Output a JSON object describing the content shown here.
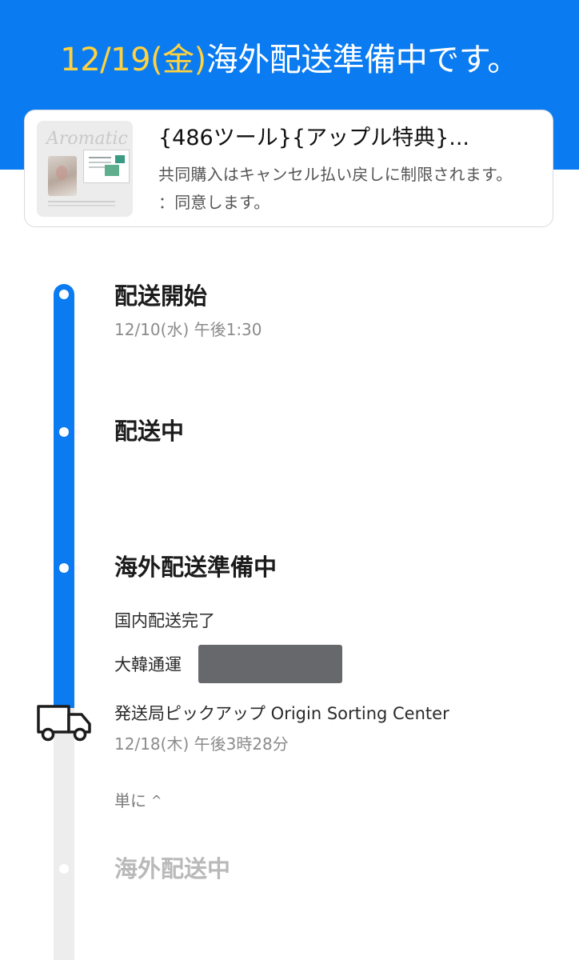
{
  "header": {
    "date": "12/19(金)",
    "status_text": "海外配送準備中です。"
  },
  "product": {
    "thumbnail_text": "Aromatic",
    "title": "{486ツール}{アップル特典}...",
    "note": "共同購入はキャンセル払い戻しに制限されます。 ：同意します。"
  },
  "timeline": {
    "steps": [
      {
        "title": "配送開始",
        "time": "12/10(水) 午後1:30",
        "state": "done"
      },
      {
        "title": "配送中",
        "state": "done"
      },
      {
        "title": "海外配送準備中",
        "state": "current",
        "details": {
          "domestic_status": "国内配送完了",
          "carrier": "大韓通運",
          "event": "発送局ピックアップ Origin Sorting Center",
          "event_time": "12/18(木) 午後3時28分"
        }
      },
      {
        "title": "海外配送中",
        "state": "upcoming"
      }
    ],
    "collapse_label": "単に",
    "current_icon": "delivery-truck-icon"
  },
  "colors": {
    "accent": "#0a7bf0",
    "date_highlight": "#ffd23f",
    "track_inactive": "#ededed"
  }
}
